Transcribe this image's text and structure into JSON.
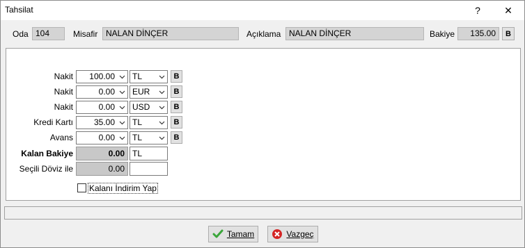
{
  "window": {
    "title": "Tahsilat",
    "help_glyph": "?",
    "close_glyph": "✕"
  },
  "header": {
    "oda_label": "Oda",
    "oda_value": "104",
    "misafir_label": "Misafir",
    "misafir_value": "NALAN DİNÇER",
    "aciklama_label": "Açıklama",
    "aciklama_value": "NALAN DİNÇER",
    "bakiye_label": "Bakiye",
    "bakiye_value": "135.00",
    "b_label": "B"
  },
  "payments": [
    {
      "label": "Nakit",
      "amount": "100.00",
      "currency": "TL",
      "b": "B"
    },
    {
      "label": "Nakit",
      "amount": "0.00",
      "currency": "EUR",
      "b": "B"
    },
    {
      "label": "Nakit",
      "amount": "0.00",
      "currency": "USD",
      "b": "B"
    },
    {
      "label": "Kredi Kartı",
      "amount": "35.00",
      "currency": "TL",
      "b": "B"
    },
    {
      "label": "Avans",
      "amount": "0.00",
      "currency": "TL",
      "b": "B"
    }
  ],
  "summary": {
    "kalan_label": "Kalan Bakiye",
    "kalan_value": "0.00",
    "kalan_currency": "TL",
    "secili_label": "Seçili Döviz ile",
    "secili_value": "0.00",
    "secili_currency": ""
  },
  "discount_checkbox": {
    "label": "Kalanı İndirim Yap",
    "checked": false
  },
  "buttons": {
    "ok_label": "Tamam",
    "cancel_label": "Vazgeç"
  },
  "colors": {
    "ok_check": "#3aa63a",
    "cancel_red": "#d42424"
  },
  "icons": {
    "ok": "check-icon",
    "cancel": "cancel-x-icon",
    "dropdown": "chevron-down-icon"
  }
}
